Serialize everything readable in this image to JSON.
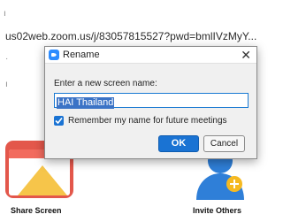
{
  "background": {
    "url": "us02web.zoom.us/j/83057815527?pwd=bmlIVzMyY...",
    "markers": [
      "ı",
      "·",
      "ı"
    ],
    "share_screen_label": "Share Screen",
    "invite_others_label": "Invite Others",
    "share_icon_name": "share-screen-icon",
    "invite_icon_name": "invite-others-icon"
  },
  "dialog": {
    "title": "Rename",
    "close_glyph": "✕",
    "prompt": "Enter a new screen name:",
    "input_value": "HAI Thailand",
    "remember_label": "Remember my name for future meetings",
    "remember_checked": true,
    "ok_label": "OK",
    "cancel_label": "Cancel"
  },
  "colors": {
    "accent": "#1a73d3",
    "share_red": "#e3574b",
    "invite_blue": "#2f7fd8"
  }
}
